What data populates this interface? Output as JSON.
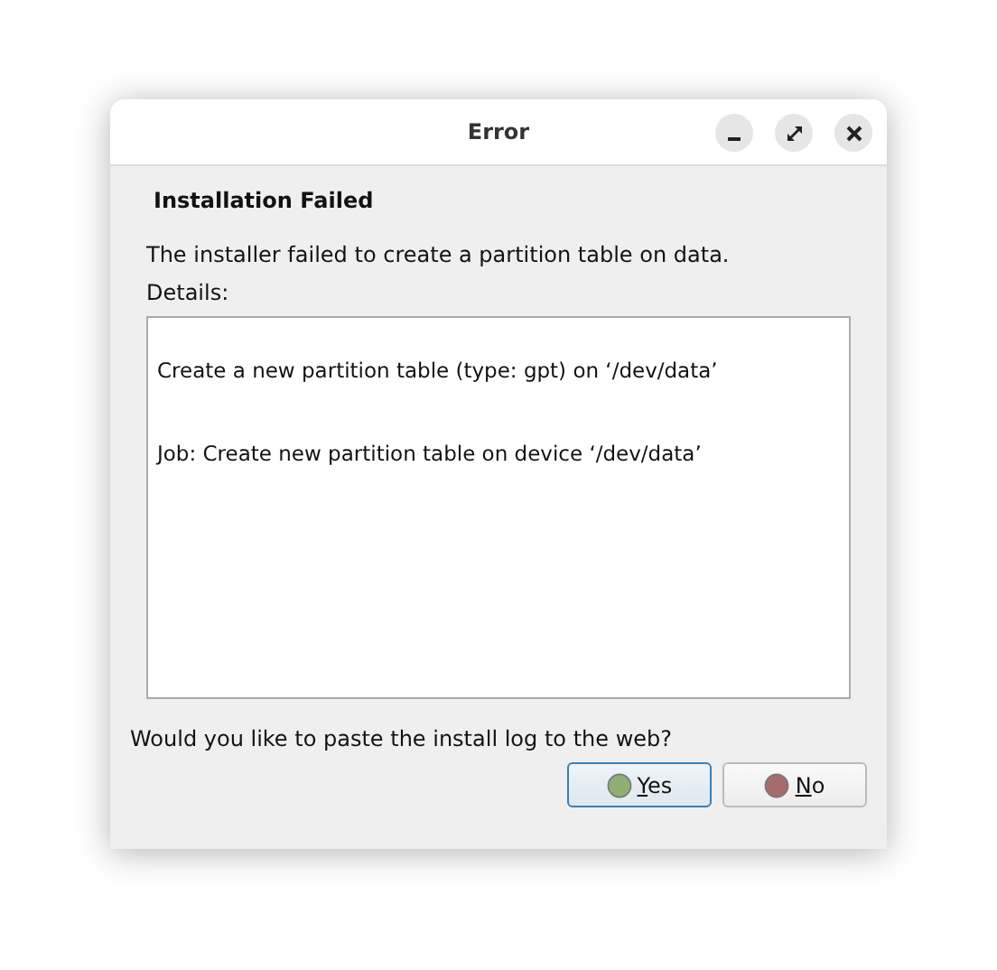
{
  "window": {
    "title": "Error"
  },
  "heading": "Installation Failed",
  "message": "The installer failed to create a partition table on data.",
  "details_label": "Details:",
  "details": [
    "Create a new partition table (type: gpt) on ‘/dev/data’",
    "Job: Create new partition table on device ‘/dev/data’"
  ],
  "question": "Would you like to paste the install log to the web?",
  "buttons": [
    {
      "label": "Yes",
      "kind": "yes",
      "default": true
    },
    {
      "label": "No",
      "kind": "no",
      "default": false
    }
  ]
}
